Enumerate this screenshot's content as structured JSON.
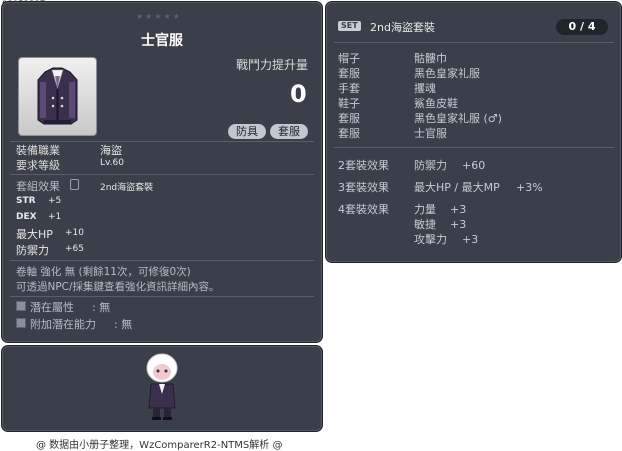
{
  "item_id": "01052397",
  "item": {
    "stars": "★★★★★",
    "name": "士官服",
    "power_label": "戰鬥力提升量",
    "power_value": "0",
    "tags": [
      "防具",
      "套服"
    ],
    "job_label": "裝備職業",
    "job_value": "海盜",
    "level_label": "要求等級",
    "level_value": "Lv.60",
    "set_effect_label": "套組效果",
    "set_effect_value": "2nd海盜套裝",
    "stats": [
      {
        "name": "STR",
        "value": "+5"
      },
      {
        "name": "DEX",
        "value": "+1"
      },
      {
        "name": "最大HP",
        "value": "+10"
      },
      {
        "name": "防禦力",
        "value": "+65"
      }
    ],
    "scroll_line": "卷軸 強化 無 (剩餘11次，可修復0次)",
    "npc_line": "可透過NPC/採集鍵查看強化資訊詳細內容。",
    "potential_label": "潛在屬性",
    "potential_value": ": 無",
    "bonus_potential_label": "附加潛在能力",
    "bonus_potential_value": ": 無"
  },
  "set": {
    "badge": "SET",
    "title": "2nd海盜套裝",
    "count": "0 / 4",
    "parts": [
      {
        "slot": "帽子",
        "name": "骷髏巾"
      },
      {
        "slot": "套服",
        "name": "黑色皇家礼服"
      },
      {
        "slot": "手套",
        "name": "攫魂"
      },
      {
        "slot": "鞋子",
        "name": "鯊鱼皮鞋"
      },
      {
        "slot": "套服",
        "name": "黑色皇家礼服 (♂)"
      },
      {
        "slot": "套服",
        "name": "士官服"
      }
    ],
    "effects": [
      {
        "label": "2套裝效果",
        "lines": [
          {
            "stat": "防禦力",
            "value": "+60"
          }
        ]
      },
      {
        "label": "3套裝效果",
        "lines": [
          {
            "stat": "最大HP / 最大MP",
            "value": "+3%"
          }
        ]
      },
      {
        "label": "4套裝效果",
        "lines": [
          {
            "stat": "力量",
            "value": "+3"
          },
          {
            "stat": "敏捷",
            "value": "+3"
          },
          {
            "stat": "攻擊力",
            "value": "+3"
          }
        ]
      }
    ]
  },
  "footer": "@ 数据由小册子整理，WzComparerR2-NTMS解析 @"
}
